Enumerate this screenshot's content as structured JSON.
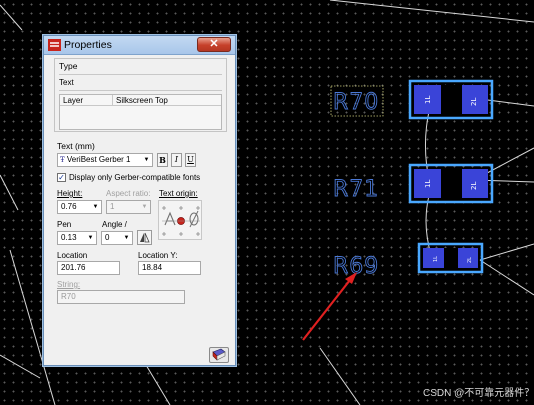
{
  "window": {
    "title": "Properties",
    "close_glyph": "✕"
  },
  "type_section": {
    "label": "Type",
    "value": "Text",
    "table": {
      "headers": [
        "Layer",
        "Silkscreen Top"
      ]
    }
  },
  "text_section": {
    "label": "Text (mm)",
    "font_value": "VeriBest Gerber 1",
    "bold_label": "B",
    "italic_label": "I",
    "underline_label": "U",
    "gerber_checkbox_label": "Display only Gerber-compatible fonts",
    "gerber_checked": true,
    "height_label": "Height:",
    "height_value": "0.76",
    "aspect_label": "Aspect ratio:",
    "aspect_value": "1",
    "origin_label": "Text origin:",
    "pen_label": "Pen",
    "pen_value": "0.13",
    "angle_label": "Angle /",
    "angle_value": "0",
    "location_label": "Location",
    "location_x": "201.76",
    "location_y_label": "Location Y:",
    "location_y": "18.84",
    "string_label": "String:",
    "string_value": "R70"
  },
  "canvas": {
    "refdes": [
      "R70",
      "R71",
      "R69"
    ],
    "pad_labels": [
      "1L",
      "2L"
    ],
    "watermark": "CSDN @不可靠元器件？"
  },
  "colors": {
    "background": "#000000",
    "refdes": "#4a78d6",
    "pad": "#3a44d8",
    "pad_outline": "#4aa8ff",
    "arrow": "#e02020",
    "dialog_bg": "#f0f0f0"
  },
  "icons": [
    "properties-app-icon",
    "close-icon",
    "truetype-font-icon",
    "chevron-down-icon",
    "text-origin-icon",
    "mirror-icon",
    "help-book-icon",
    "red-arrow-annotation"
  ]
}
